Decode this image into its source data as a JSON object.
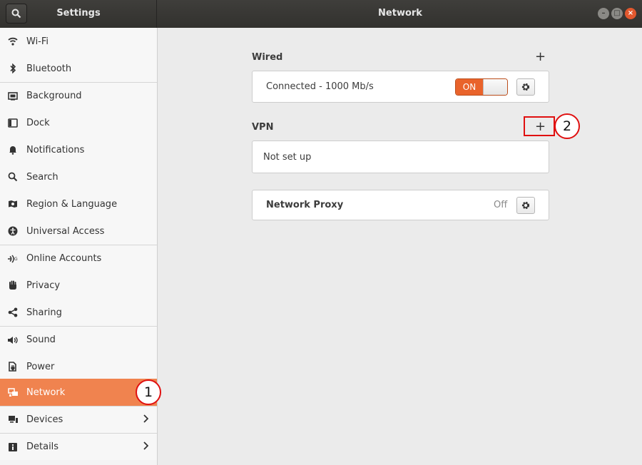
{
  "titlebar": {
    "left_title": "Settings",
    "main_title": "Network"
  },
  "sidebar": {
    "items": [
      {
        "label": "Wi-Fi",
        "icon": "wifi-icon"
      },
      {
        "label": "Bluetooth",
        "icon": "bluetooth-icon"
      },
      {
        "label": "Background",
        "icon": "background-icon"
      },
      {
        "label": "Dock",
        "icon": "dock-icon"
      },
      {
        "label": "Notifications",
        "icon": "bell-icon"
      },
      {
        "label": "Search",
        "icon": "search-icon"
      },
      {
        "label": "Region & Language",
        "icon": "region-icon"
      },
      {
        "label": "Universal Access",
        "icon": "accessibility-icon"
      },
      {
        "label": "Online Accounts",
        "icon": "online-accounts-icon"
      },
      {
        "label": "Privacy",
        "icon": "hand-icon"
      },
      {
        "label": "Sharing",
        "icon": "share-icon"
      },
      {
        "label": "Sound",
        "icon": "speaker-icon"
      },
      {
        "label": "Power",
        "icon": "power-icon"
      },
      {
        "label": "Network",
        "icon": "network-icon",
        "active": true
      },
      {
        "label": "Devices",
        "icon": "devices-icon",
        "chevron": true
      },
      {
        "label": "Details",
        "icon": "info-icon",
        "chevron": true
      }
    ]
  },
  "wired": {
    "title": "Wired",
    "add": "+",
    "connection": "Connected - 1000 Mb/s",
    "toggle": "ON"
  },
  "vpn": {
    "title": "VPN",
    "add": "+",
    "status": "Not set up"
  },
  "proxy": {
    "label": "Network Proxy",
    "status": "Off"
  },
  "annotations": {
    "first": "1",
    "second": "2"
  },
  "colors": {
    "accent": "#f0834f",
    "toggle_on": "#e9632b",
    "highlight": "#e01010",
    "titlebar": "#3a3936"
  }
}
